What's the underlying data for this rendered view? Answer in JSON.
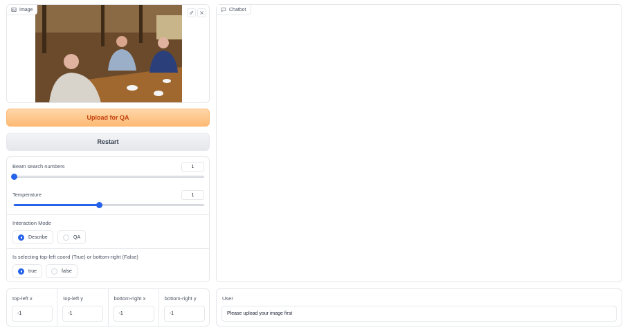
{
  "image_panel": {
    "label": "Image"
  },
  "upload_button": {
    "label": "Upload for QA"
  },
  "restart_button": {
    "label": "Restart"
  },
  "beam": {
    "label": "Beam search numbers",
    "value": "1",
    "fraction": 0.0
  },
  "temperature": {
    "label": "Temperature",
    "value": "1",
    "fraction": 0.45
  },
  "interaction_mode": {
    "label": "Interaction Mode",
    "options": [
      "Describe",
      "QA"
    ],
    "selected": "Describe"
  },
  "coord_mode": {
    "label": "Is selecting top-left coord (True) or bottom-right (False)",
    "options": [
      "true",
      "false"
    ],
    "selected": "true"
  },
  "chatbot": {
    "label": "Chatbot"
  },
  "coords": [
    {
      "label": "top-left x",
      "value": "-1"
    },
    {
      "label": "top-left y",
      "value": "-1"
    },
    {
      "label": "bottom-right x",
      "value": "-1"
    },
    {
      "label": "bottom-right y",
      "value": "-1"
    }
  ],
  "user": {
    "label": "User",
    "value": "Please upload your image first"
  },
  "colors": {
    "accent": "#2563eb",
    "upload_bg": "#fdba74",
    "upload_text": "#c2410c"
  }
}
